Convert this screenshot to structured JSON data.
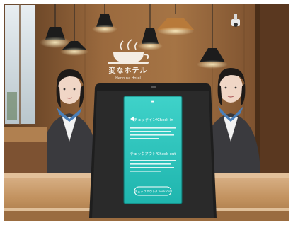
{
  "signage": {
    "brand_jp": "変なホテル",
    "brand_en": "Henn na Hotel"
  },
  "kiosk": {
    "checkin_label": "チェックイン/Check-in",
    "checkout_label": "チェックアウト/Check-out",
    "button_label": "チェックアウト/Check-out"
  },
  "colors": {
    "wall": "#8a5a33",
    "counter": "#c79a6c",
    "kiosk_screen": "#2fc9c0",
    "kiosk_body": "#1e1e1e"
  },
  "icons": [
    "pendant-lamp-icon",
    "cup-logo-icon",
    "security-camera-icon"
  ]
}
